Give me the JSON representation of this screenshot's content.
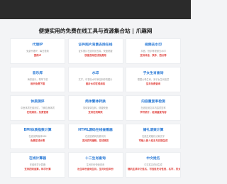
{
  "header": {
    "title": "便捷实用的免费在线工具与资源集合站 | 爪趣网"
  },
  "cards": [
    {
      "title": "代理IP",
      "desc": "免费代理IP，每日更新",
      "tags": "提供IP"
    },
    {
      "title": "证件照片背景去除在线",
      "desc": "证件照片在线背景去除，快速便捷",
      "tags": "快速去除在线免费用"
    },
    {
      "title": "视频去水印",
      "desc": "抖音，快手等视频去水印",
      "tags": "支持抖音、快手、西瓜等"
    },
    {
      "title": "音乐库",
      "desc": "海量音乐，歌单下载",
      "tags": "音乐免费下载"
    },
    {
      "title": "水印",
      "desc": "文字，可视化水印添加到你的图片",
      "tags": "图片水印在线添加"
    },
    {
      "title": "子女生肖查询",
      "desc": "根据父母生肖，测子女生肖宜忌",
      "tags": "生肖免费查询"
    },
    {
      "title": "体质测评",
      "desc": "中医体质在线测试，了解自身体质",
      "tags": "在线测试，免费使用"
    },
    {
      "title": "简体繁体转换",
      "desc": "简体繁体互转，便捷快速",
      "tags": "支持在线转换"
    },
    {
      "title": "内容重复率检测",
      "desc": "在线检测文本内容重复率",
      "tags": "字符统计，检测重复内容"
    },
    {
      "title": "BMI体质指数计算",
      "desc": "在线测算身体BMI",
      "tags": "免费在线计算"
    },
    {
      "title": "HTML源码在线查看器",
      "desc": "在线查看网页源代码",
      "tags": "支持实时编辑，在线预览"
    },
    {
      "title": "婚礼请柬计算",
      "desc": "在线生成婚礼请柬文字",
      "tags": "可输入新人姓名与日期生成"
    },
    {
      "title": "在线计算器",
      "desc": "在线科学计算器",
      "tags": "支持四则运算，科学计算"
    },
    {
      "title": "十二生肖查询",
      "desc": "生肖年份快速查询",
      "tags": "出生年份查询生肖，生肖对应年份"
    },
    {
      "title": "中文姓名",
      "desc": "中文姓名在线生成",
      "tags": "随机生成中文姓名，可选姓氏与性别，名字，男女"
    }
  ]
}
